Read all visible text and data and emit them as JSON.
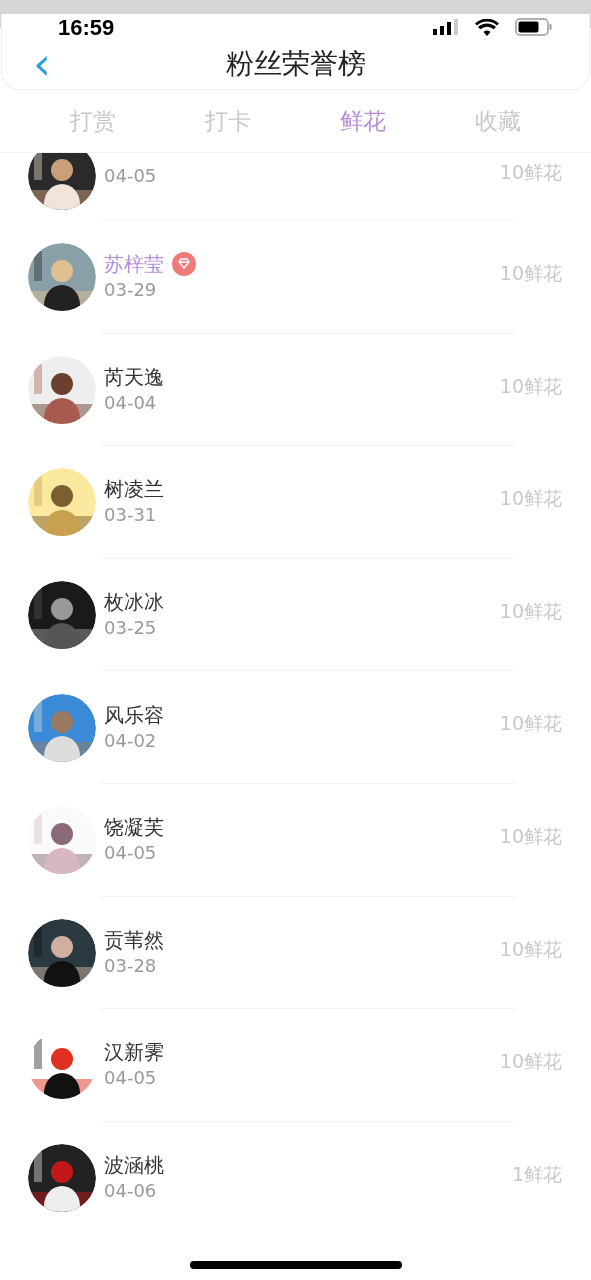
{
  "status_bar": {
    "time": "16:59"
  },
  "header": {
    "back": "‹",
    "title": "粉丝荣誉榜"
  },
  "tabs": [
    {
      "label": "打赏",
      "selected": false
    },
    {
      "label": "打卡",
      "selected": false
    },
    {
      "label": "鲜花",
      "selected": true
    },
    {
      "label": "收藏",
      "selected": false
    }
  ],
  "fans": [
    {
      "kind": "partial",
      "date": "04-05",
      "amount": "10鲜花",
      "vip": false
    },
    {
      "kind": "full",
      "name": "苏梓莹",
      "date": "03-29",
      "amount": "10鲜花",
      "vip": true
    },
    {
      "kind": "full",
      "name": "芮天逸",
      "date": "04-04",
      "amount": "10鲜花",
      "vip": false
    },
    {
      "kind": "full",
      "name": "树凌兰",
      "date": "03-31",
      "amount": "10鲜花",
      "vip": false
    },
    {
      "kind": "full",
      "name": "枚冰冰",
      "date": "03-25",
      "amount": "10鲜花",
      "vip": false
    },
    {
      "kind": "full",
      "name": "风乐容",
      "date": "04-02",
      "amount": "10鲜花",
      "vip": false
    },
    {
      "kind": "full",
      "name": "饶凝芙",
      "date": "04-05",
      "amount": "10鲜花",
      "vip": false
    },
    {
      "kind": "full",
      "name": "贡苇然",
      "date": "03-28",
      "amount": "10鲜花",
      "vip": false
    },
    {
      "kind": "full",
      "name": "汉新霁",
      "date": "04-05",
      "amount": "10鲜花",
      "vip": false
    },
    {
      "kind": "full",
      "name": "波涵桃",
      "date": "04-06",
      "amount": "1鲜花",
      "vip": false
    }
  ]
}
